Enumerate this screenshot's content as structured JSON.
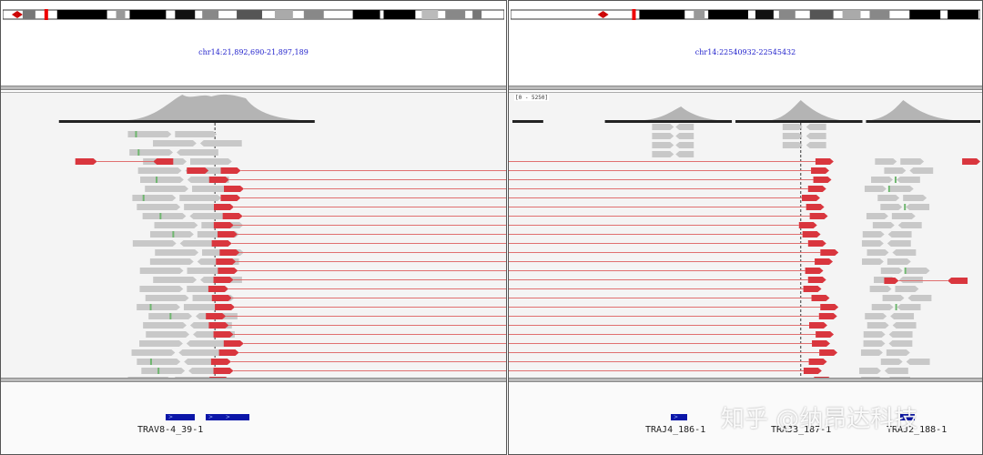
{
  "panels": [
    {
      "locus": "chr14:21,892,690-21,897,189",
      "genes": [
        {
          "name": "TRAV8-4_39-1",
          "arrows": "> > > >"
        }
      ]
    },
    {
      "locus": "chr14:22540932-22545432",
      "range_label": "[0 - 5250]",
      "genes": [
        {
          "name": "TRAJ4_186-1",
          "arrows": "> >"
        },
        {
          "name": "TRAJ3_187-1",
          "arrows": ">"
        },
        {
          "name": "TRAJ2_188-1",
          "arrows": ">"
        }
      ]
    }
  ],
  "colors": {
    "read_gray": "#c8c8c8",
    "soft_clip_red": "#d9363e",
    "junction_line": "#e07070",
    "coverage": "#b4b4b4",
    "gene_blue": "#0b16a8",
    "locus_text": "#2222cc"
  },
  "watermark": "知乎 @纳昂达科技"
}
